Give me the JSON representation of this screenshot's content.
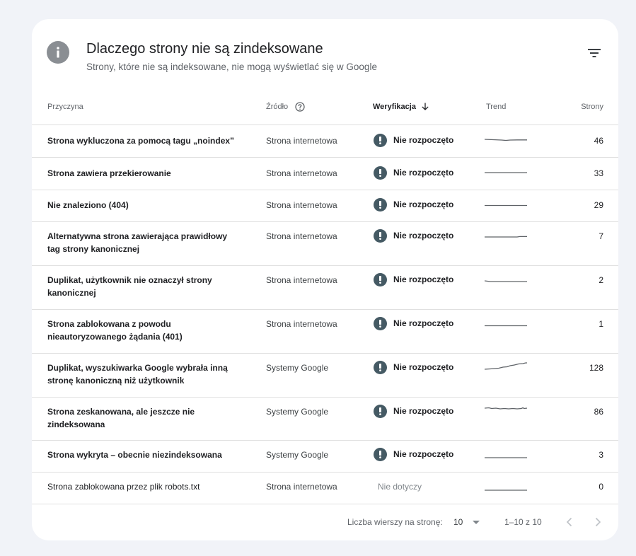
{
  "header": {
    "title": "Dlaczego strony nie są zindeksowane",
    "subtitle": "Strony, które nie są indeksowane, nie mogą wyświetlać się w Google",
    "info_icon": "info-icon",
    "filter_icon": "filter-icon"
  },
  "columns": {
    "reason": "Przyczyna",
    "source": "Źródło",
    "verification": "Weryfikacja",
    "trend": "Trend",
    "pages": "Strony"
  },
  "rows": [
    {
      "reason": "Strona wykluczona za pomocą tagu „noindex”",
      "source": "Strona internetowa",
      "verification": "Nie rozpoczęto",
      "pages": "46"
    },
    {
      "reason": "Strona zawiera przekierowanie",
      "source": "Strona internetowa",
      "verification": "Nie rozpoczęto",
      "pages": "33"
    },
    {
      "reason": "Nie znaleziono (404)",
      "source": "Strona internetowa",
      "verification": "Nie rozpoczęto",
      "pages": "29"
    },
    {
      "reason": "Alternatywna strona zawierająca prawidłowy tag strony kanonicznej",
      "source": "Strona internetowa",
      "verification": "Nie rozpoczęto",
      "pages": "7"
    },
    {
      "reason": "Duplikat, użytkownik nie oznaczył strony kanonicznej",
      "source": "Strona internetowa",
      "verification": "Nie rozpoczęto",
      "pages": "2"
    },
    {
      "reason": "Strona zablokowana z powodu nieautoryzowanego żądania (401)",
      "source": "Strona internetowa",
      "verification": "Nie rozpoczęto",
      "pages": "1"
    },
    {
      "reason": "Duplikat, wyszukiwarka Google wybrała inną stronę kanoniczną niż użytkownik",
      "source": "Systemy Google",
      "verification": "Nie rozpoczęto",
      "pages": "128"
    },
    {
      "reason": "Strona zeskanowana, ale jeszcze nie zindeksowana",
      "source": "Systemy Google",
      "verification": "Nie rozpoczęto",
      "pages": "86"
    },
    {
      "reason": "Strona wykryta – obecnie niezindeksowana",
      "source": "Systemy Google",
      "verification": "Nie rozpoczęto",
      "pages": "3"
    },
    {
      "reason": "Strona zablokowana przez plik robots.txt",
      "source": "Strona internetowa",
      "verification": "Nie dotyczy",
      "pages": "0"
    }
  ],
  "footer": {
    "rows_per_page_label": "Liczba wierszy na stronę:",
    "rows_per_page_value": "10",
    "range": "1–10 z 10",
    "prev_icon": "chevron-left-icon",
    "next_icon": "chevron-right-icon"
  },
  "colors": {
    "status_icon": "#455a64",
    "background": "#f1f3f8",
    "divider": "#e0e0e0"
  }
}
